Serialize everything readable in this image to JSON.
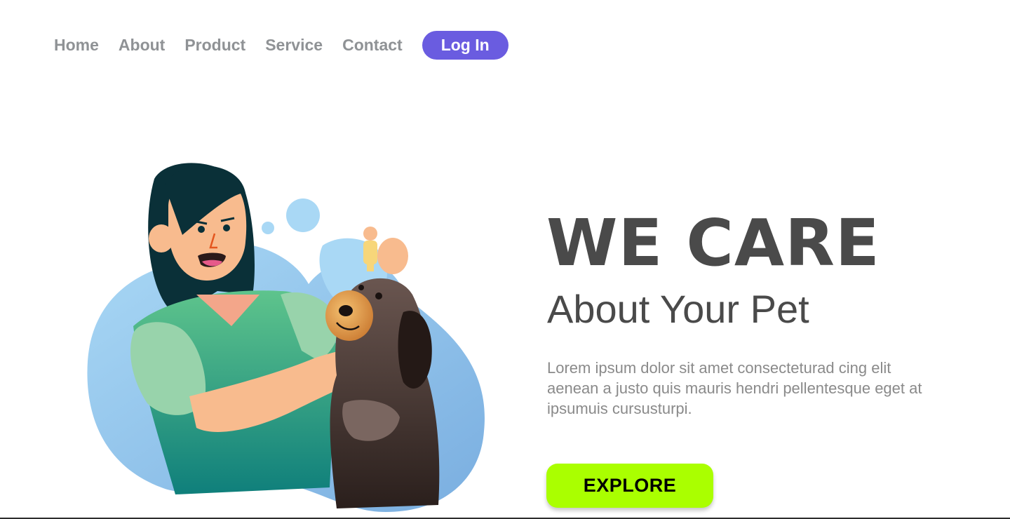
{
  "nav": {
    "items": [
      {
        "label": "Home"
      },
      {
        "label": "About"
      },
      {
        "label": "Product"
      },
      {
        "label": "Service"
      },
      {
        "label": "Contact"
      }
    ],
    "login_label": "Log In"
  },
  "hero": {
    "title": "WE CARE",
    "subtitle": "About Your Pet",
    "body": "Lorem ipsum dolor sit amet consecteturad cing elit aenean a justo quis mauris hendri pellentesque eget at ipsumuis cursusturpi.",
    "cta_label": "EXPLORE"
  },
  "colors": {
    "accent": "#6a5ce0",
    "cta": "#aaff00",
    "heading": "#4a4a4a",
    "nav_text": "#8f9295",
    "body_text": "#8a8a8a"
  }
}
